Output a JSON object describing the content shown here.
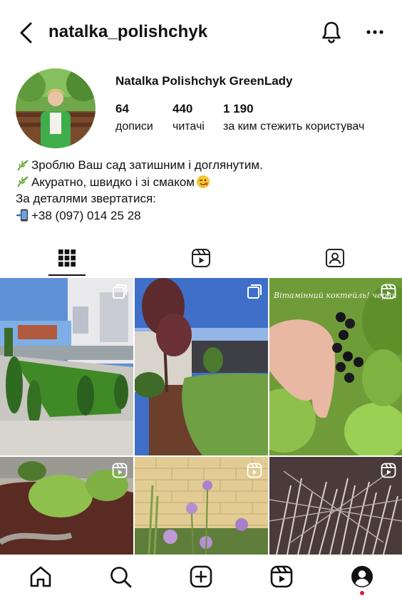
{
  "header": {
    "username": "natalka_polishchyk",
    "back_icon": "chevron-left-icon",
    "bell_icon": "bell-icon",
    "more_icon": "more-horizontal-icon"
  },
  "profile": {
    "display_name": "Natalka Polishchyk GreenLady",
    "stats": {
      "posts": {
        "count": "64",
        "label": "дописи"
      },
      "followers": {
        "count": "440",
        "label": "читачі"
      },
      "following": {
        "count": "1 190",
        "label": "за ким стежить користувач"
      }
    },
    "bio": [
      {
        "emoji": "herb-icon",
        "text": "Зроблю Ваш сад затишним і доглянутим."
      },
      {
        "emoji": "herb-icon",
        "text": "Акуратно, швидко і зі смаком",
        "trailing_emoji": "winking-face-icon"
      },
      {
        "text": "За деталями звертатися:"
      },
      {
        "emoji": "mobile-phone-arrow-icon",
        "text": "+38 (097) 014 25 28"
      }
    ]
  },
  "tabs": [
    {
      "name": "posts-grid",
      "icon": "grid-icon",
      "active": true
    },
    {
      "name": "reels",
      "icon": "reels-icon",
      "active": false
    },
    {
      "name": "tagged",
      "icon": "tagged-icon",
      "active": false
    }
  ],
  "grid": [
    {
      "kind": "carousel",
      "icon": "carousel-icon",
      "description_icon": "house-lawn-photo"
    },
    {
      "kind": "carousel",
      "icon": "carousel-icon",
      "description_icon": "garden-tree-photo"
    },
    {
      "kind": "reel",
      "icon": "reels-icon",
      "overlay_text": "Вітамінний коктейль! черни"
    },
    {
      "kind": "reel",
      "icon": "reels-icon",
      "description_icon": "lavender-bed-photo"
    },
    {
      "kind": "reel",
      "icon": "reels-icon",
      "description_icon": "allium-wall-photo"
    },
    {
      "kind": "reel",
      "icon": "reels-icon",
      "overlay_text": ""
    }
  ],
  "bottom_nav": [
    {
      "name": "home",
      "icon": "home-icon"
    },
    {
      "name": "search",
      "icon": "search-icon"
    },
    {
      "name": "create",
      "icon": "plus-square-icon"
    },
    {
      "name": "reels",
      "icon": "reels-icon"
    },
    {
      "name": "profile",
      "icon": "profile-icon",
      "notification": true
    }
  ],
  "colors": {
    "text": "#111111",
    "notification_dot": "#e4173b",
    "background": "#ffffff"
  }
}
